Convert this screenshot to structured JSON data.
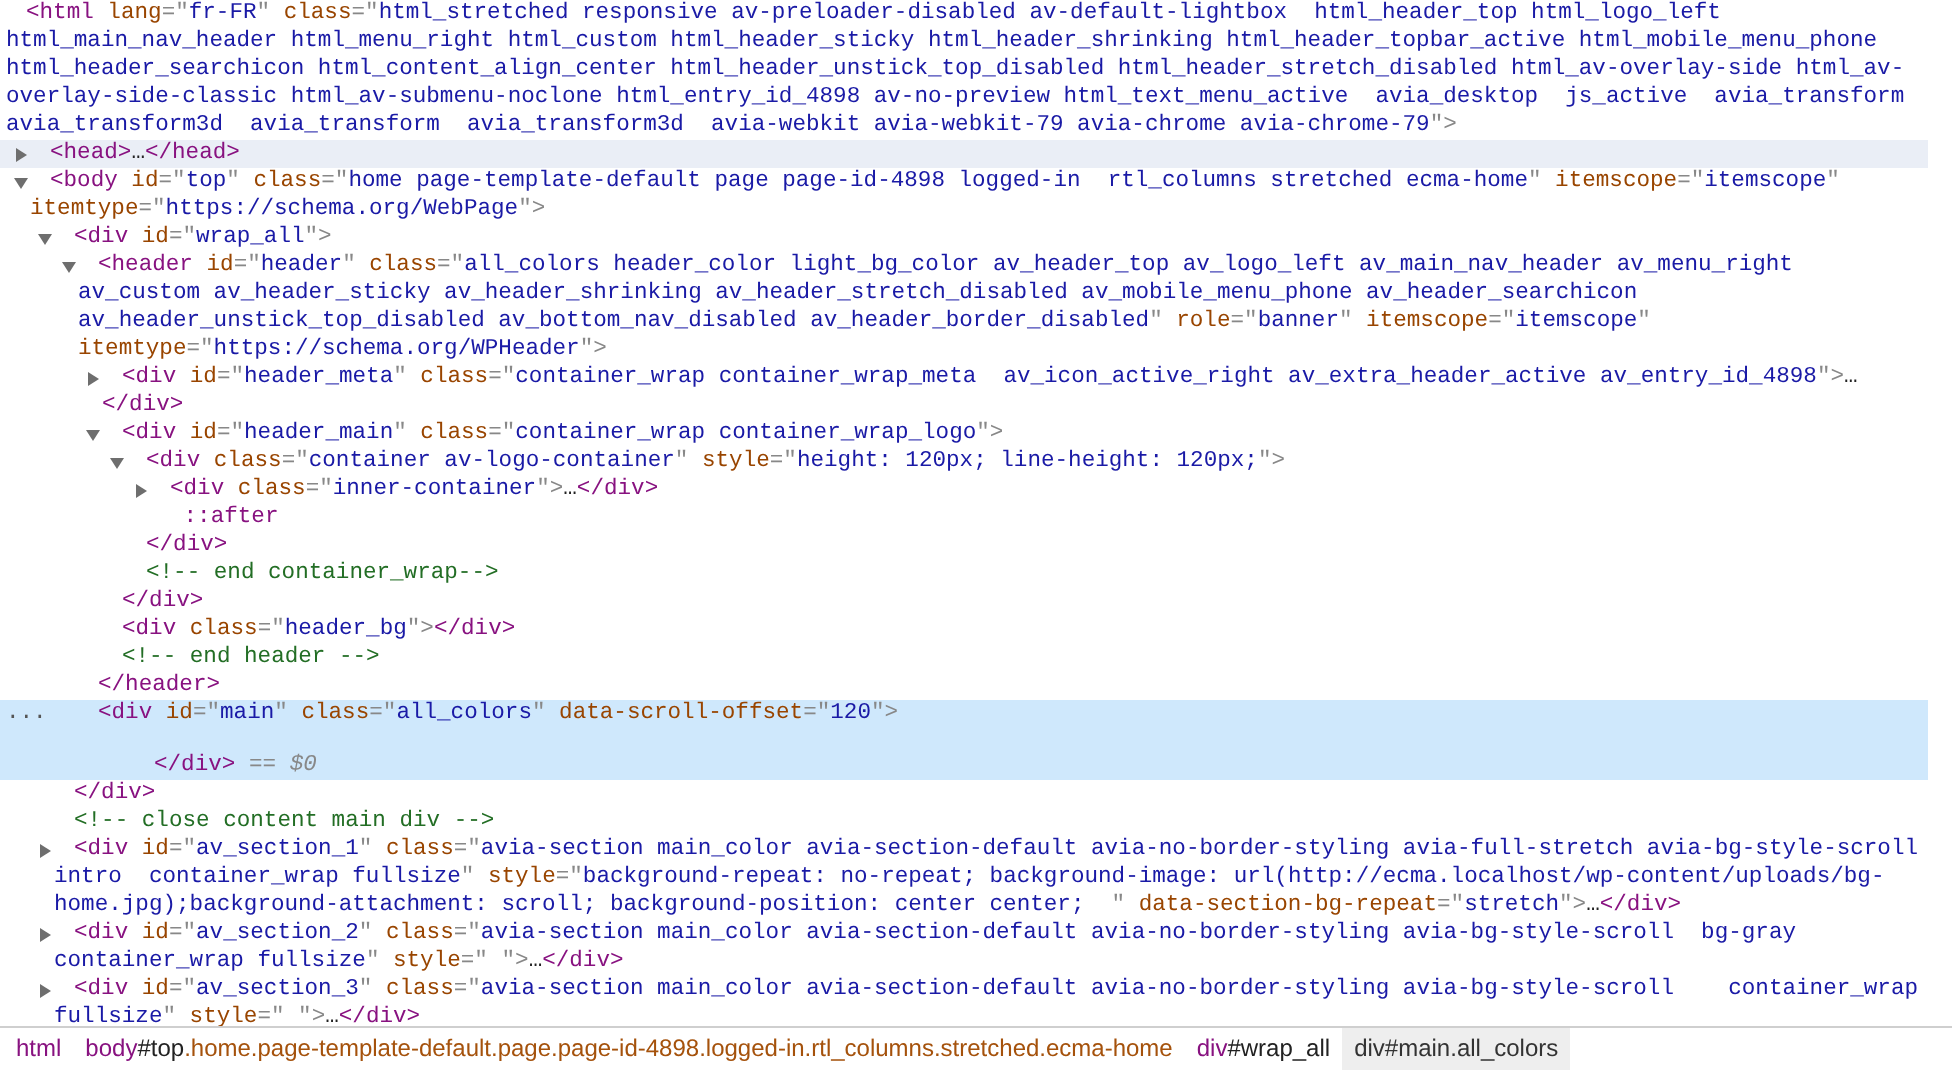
{
  "elements_tree": [
    {
      "kind": "leaf",
      "selected": false,
      "hovered": false,
      "tokens": [
        {
          "tag": "<html"
        },
        {
          "attr": " lang"
        },
        {
          "punct": "=\""
        },
        {
          "value": "fr-FR"
        },
        {
          "punct": "\""
        },
        {
          "attr": " class"
        },
        {
          "punct": "=\""
        },
        {
          "value": "html_stretched responsive av-preloader-disabled av-default-lightbox  html_header_top html_logo_left html_main_nav_header html_menu_right html_custom html_header_sticky html_header_shrinking html_header_topbar_active html_mobile_menu_phone html_header_searchicon html_content_align_center html_header_unstick_top_disabled html_header_stretch_disabled html_av-overlay-side html_av-overlay-side-classic html_av-submenu-noclone html_entry_id_4898 av-no-preview html_text_menu_active  avia_desktop  js_active  avia_transform avia_transform3d  avia_transform  avia_transform3d  avia-webkit avia-webkit-79 avia-chrome avia-chrome-79"
        },
        {
          "punct": "\">"
        }
      ],
      "children": [
        {
          "kind": "element",
          "expanded": false,
          "selected": false,
          "hovered": true,
          "tokens": [
            {
              "tag": "<head>"
            },
            {
              "text": "…"
            },
            {
              "tag": "</head>"
            }
          ]
        },
        {
          "kind": "element",
          "expanded": true,
          "selected": false,
          "hovered": false,
          "tokens": [
            {
              "tag": "<body"
            },
            {
              "attr": " id"
            },
            {
              "punct": "=\""
            },
            {
              "value": "top"
            },
            {
              "punct": "\""
            },
            {
              "attr": " class"
            },
            {
              "punct": "=\""
            },
            {
              "value": "home page-template-default page page-id-4898 logged-in  rtl_columns stretched ecma-home"
            },
            {
              "punct": "\""
            },
            {
              "attr": " itemscope"
            },
            {
              "punct": "=\""
            },
            {
              "value": "itemscope"
            },
            {
              "punct": "\""
            },
            {
              "attr": " itemtype"
            },
            {
              "punct": "=\""
            },
            {
              "value": "https://schema.org/WebPage"
            },
            {
              "punct": "\">"
            }
          ],
          "children": [
            {
              "kind": "element",
              "expanded": true,
              "selected": false,
              "hovered": false,
              "tokens": [
                {
                  "tag": "<div"
                },
                {
                  "attr": " id"
                },
                {
                  "punct": "=\""
                },
                {
                  "value": "wrap_all"
                },
                {
                  "punct": "\">"
                }
              ],
              "children": [
                {
                  "kind": "element",
                  "expanded": true,
                  "selected": false,
                  "hovered": false,
                  "tokens": [
                    {
                      "tag": "<header"
                    },
                    {
                      "attr": " id"
                    },
                    {
                      "punct": "=\""
                    },
                    {
                      "value": "header"
                    },
                    {
                      "punct": "\""
                    },
                    {
                      "attr": " class"
                    },
                    {
                      "punct": "=\""
                    },
                    {
                      "value": "all_colors header_color light_bg_color av_header_top av_logo_left av_main_nav_header av_menu_right av_custom av_header_sticky av_header_shrinking av_header_stretch_disabled av_mobile_menu_phone av_header_searchicon av_header_unstick_top_disabled av_bottom_nav_disabled av_header_border_disabled"
                    },
                    {
                      "punct": "\""
                    },
                    {
                      "attr": " role"
                    },
                    {
                      "punct": "=\""
                    },
                    {
                      "value": "banner"
                    },
                    {
                      "punct": "\""
                    },
                    {
                      "attr": " itemscope"
                    },
                    {
                      "punct": "=\""
                    },
                    {
                      "value": "itemscope"
                    },
                    {
                      "punct": "\""
                    },
                    {
                      "attr": " itemtype"
                    },
                    {
                      "punct": "=\""
                    },
                    {
                      "value": "https://schema.org/WPHeader"
                    },
                    {
                      "punct": "\">"
                    }
                  ],
                  "children": [
                    {
                      "kind": "element",
                      "expanded": false,
                      "selected": false,
                      "hovered": false,
                      "tokens": [
                        {
                          "tag": "<div"
                        },
                        {
                          "attr": " id"
                        },
                        {
                          "punct": "=\""
                        },
                        {
                          "value": "header_meta"
                        },
                        {
                          "punct": "\""
                        },
                        {
                          "attr": " class"
                        },
                        {
                          "punct": "=\""
                        },
                        {
                          "value": "container_wrap container_wrap_meta  av_icon_active_right av_extra_header_active av_entry_id_4898"
                        },
                        {
                          "punct": "\">"
                        },
                        {
                          "text": "…"
                        },
                        {
                          "tag": "</div>"
                        }
                      ]
                    },
                    {
                      "kind": "element",
                      "expanded": true,
                      "selected": false,
                      "hovered": false,
                      "tokens": [
                        {
                          "tag": "<div"
                        },
                        {
                          "attr": " id"
                        },
                        {
                          "punct": "=\""
                        },
                        {
                          "value": "header_main"
                        },
                        {
                          "punct": "\""
                        },
                        {
                          "attr": " class"
                        },
                        {
                          "punct": "=\""
                        },
                        {
                          "value": "container_wrap container_wrap_logo"
                        },
                        {
                          "punct": "\">"
                        }
                      ],
                      "children": [
                        {
                          "kind": "element",
                          "expanded": true,
                          "selected": false,
                          "hovered": false,
                          "tokens": [
                            {
                              "tag": "<div"
                            },
                            {
                              "attr": " class"
                            },
                            {
                              "punct": "=\""
                            },
                            {
                              "value": "container av-logo-container"
                            },
                            {
                              "punct": "\""
                            },
                            {
                              "attr": " style"
                            },
                            {
                              "punct": "=\""
                            },
                            {
                              "value": "height: 120px; line-height: 120px;"
                            },
                            {
                              "punct": "\">"
                            }
                          ],
                          "children": [
                            {
                              "kind": "element",
                              "expanded": false,
                              "selected": false,
                              "hovered": false,
                              "tokens": [
                                {
                                  "tag": "<div"
                                },
                                {
                                  "attr": " class"
                                },
                                {
                                  "punct": "=\""
                                },
                                {
                                  "value": "inner-container"
                                },
                                {
                                  "punct": "\">"
                                },
                                {
                                  "text": "…"
                                },
                                {
                                  "tag": "</div>"
                                }
                              ]
                            },
                            {
                              "kind": "leaf",
                              "selected": false,
                              "hovered": false,
                              "tokens": [
                                {
                                  "pseudo": " ::after"
                                }
                              ]
                            }
                          ]
                        },
                        {
                          "kind": "leaf",
                          "selected": false,
                          "hovered": false,
                          "tokens": [
                            {
                              "tag": "</div>"
                            }
                          ]
                        },
                        {
                          "kind": "leaf",
                          "selected": false,
                          "hovered": false,
                          "tokens": [
                            {
                              "comment": "<!-- end container_wrap-->"
                            }
                          ]
                        }
                      ]
                    },
                    {
                      "kind": "leaf",
                      "selected": false,
                      "hovered": false,
                      "tokens": [
                        {
                          "tag": "</div>"
                        }
                      ]
                    },
                    {
                      "kind": "leaf",
                      "selected": false,
                      "hovered": false,
                      "tokens": [
                        {
                          "tag": "<div"
                        },
                        {
                          "attr": " class"
                        },
                        {
                          "punct": "=\""
                        },
                        {
                          "value": "header_bg"
                        },
                        {
                          "punct": "\">"
                        },
                        {
                          "tag": "</div>"
                        }
                      ]
                    },
                    {
                      "kind": "leaf",
                      "selected": false,
                      "hovered": false,
                      "tokens": [
                        {
                          "comment": "<!-- end header -->"
                        }
                      ]
                    }
                  ]
                },
                {
                  "kind": "leaf",
                  "selected": false,
                  "hovered": false,
                  "tokens": [
                    {
                      "tag": "</header>"
                    }
                  ]
                },
                {
                  "kind": "leaf",
                  "selected": true,
                  "hovered": false,
                  "row_menu": "...",
                  "tokens": [
                    {
                      "tag": "<div"
                    },
                    {
                      "attr": " id"
                    },
                    {
                      "punct": "=\""
                    },
                    {
                      "value": "main"
                    },
                    {
                      "punct": "\""
                    },
                    {
                      "attr": " class"
                    },
                    {
                      "punct": "=\""
                    },
                    {
                      "value": "all_colors"
                    },
                    {
                      "punct": "\""
                    },
                    {
                      "attr": " data-scroll-offset"
                    },
                    {
                      "punct": "=\""
                    },
                    {
                      "value": "120"
                    },
                    {
                      "punct": "\">"
                    }
                  ],
                  "closing": [
                    {
                      "tag": "</div>"
                    },
                    {
                      "note": " == "
                    },
                    {
                      "var": "$0"
                    }
                  ]
                }
              ]
            },
            {
              "kind": "leaf",
              "selected": false,
              "hovered": false,
              "tokens": [
                {
                  "tag": "</div>"
                }
              ]
            },
            {
              "kind": "leaf",
              "selected": false,
              "hovered": false,
              "tokens": [
                {
                  "comment": "<!-- close content main div -->"
                }
              ]
            },
            {
              "kind": "element",
              "expanded": false,
              "selected": false,
              "hovered": false,
              "tokens": [
                {
                  "tag": "<div"
                },
                {
                  "attr": " id"
                },
                {
                  "punct": "=\""
                },
                {
                  "value": "av_section_1"
                },
                {
                  "punct": "\""
                },
                {
                  "attr": " class"
                },
                {
                  "punct": "=\""
                },
                {
                  "value": "avia-section main_color avia-section-default avia-no-border-styling avia-full-stretch avia-bg-style-scroll  intro  container_wrap fullsize"
                },
                {
                  "punct": "\""
                },
                {
                  "attr": " style"
                },
                {
                  "punct": "=\""
                },
                {
                  "value": "background-repeat: no-repeat; background-image: url(http://ecma.localhost/wp-content/uploads/bg-home.jpg);background-attachment: scroll; background-position: center center;  "
                },
                {
                  "punct": "\""
                },
                {
                  "attr": " data-section-bg-repeat"
                },
                {
                  "punct": "=\""
                },
                {
                  "value": "stretch"
                },
                {
                  "punct": "\">"
                },
                {
                  "text": "…"
                },
                {
                  "tag": "</div>"
                }
              ]
            },
            {
              "kind": "element",
              "expanded": false,
              "selected": false,
              "hovered": false,
              "tokens": [
                {
                  "tag": "<div"
                },
                {
                  "attr": " id"
                },
                {
                  "punct": "=\""
                },
                {
                  "value": "av_section_2"
                },
                {
                  "punct": "\""
                },
                {
                  "attr": " class"
                },
                {
                  "punct": "=\""
                },
                {
                  "value": "avia-section main_color avia-section-default avia-no-border-styling avia-bg-style-scroll  bg-gray  container_wrap fullsize"
                },
                {
                  "punct": "\""
                },
                {
                  "attr": " style"
                },
                {
                  "punct": "=\" \">"
                },
                {
                  "text": "…"
                },
                {
                  "tag": "</div>"
                }
              ]
            },
            {
              "kind": "element",
              "expanded": false,
              "selected": false,
              "hovered": false,
              "tokens": [
                {
                  "tag": "<div"
                },
                {
                  "attr": " id"
                },
                {
                  "punct": "=\""
                },
                {
                  "value": "av_section_3"
                },
                {
                  "punct": "\""
                },
                {
                  "attr": " class"
                },
                {
                  "punct": "=\""
                },
                {
                  "value": "avia-section main_color avia-section-default avia-no-border-styling avia-bg-style-scroll    container_wrap fullsize"
                },
                {
                  "punct": "\""
                },
                {
                  "attr": " style"
                },
                {
                  "punct": "=\" \">"
                },
                {
                  "text": "…"
                },
                {
                  "tag": "</div>"
                }
              ]
            }
          ]
        }
      ]
    }
  ],
  "breadcrumbs": [
    {
      "selected": false,
      "tokens": [
        {
          "tag": "html"
        }
      ]
    },
    {
      "selected": false,
      "tokens": [
        {
          "tag": "body"
        },
        {
          "id": "#top"
        },
        {
          "class": ".home.page-template-default.page.page-id-4898.logged-in.rtl_columns.stretched.ecma-home"
        }
      ]
    },
    {
      "selected": false,
      "tokens": [
        {
          "tag": "div"
        },
        {
          "id": "#wrap_all"
        }
      ]
    },
    {
      "selected": true,
      "tokens": [
        {
          "tag": "div"
        },
        {
          "id": "#main"
        },
        {
          "class": ".all_colors"
        }
      ]
    }
  ]
}
